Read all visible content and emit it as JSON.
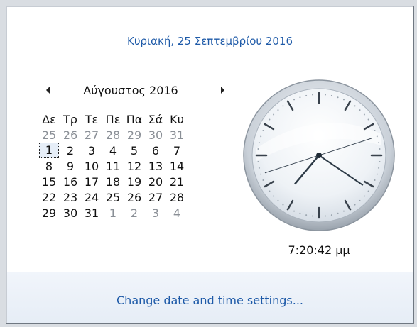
{
  "header": {
    "long_date": "Κυριακή, 25 Σεπτεμβρίου 2016"
  },
  "calendar": {
    "month_title": "Αύγουστος 2016",
    "weekdays": [
      "Δε",
      "Τρ",
      "Τε",
      "Πε",
      "Πα",
      "Σά",
      "Κυ"
    ],
    "weeks": [
      [
        "25",
        "26",
        "27",
        "28",
        "29",
        "30",
        "31"
      ],
      [
        "1",
        "2",
        "3",
        "4",
        "5",
        "6",
        "7"
      ],
      [
        "8",
        "9",
        "10",
        "11",
        "12",
        "13",
        "14"
      ],
      [
        "15",
        "16",
        "17",
        "18",
        "19",
        "20",
        "21"
      ],
      [
        "22",
        "23",
        "24",
        "25",
        "26",
        "27",
        "28"
      ],
      [
        "29",
        "30",
        "31",
        "1",
        "2",
        "3",
        "4"
      ]
    ]
  },
  "clock": {
    "time_text": "7:20:42 μμ",
    "hour": 7,
    "minute": 20,
    "second": 42
  },
  "footer": {
    "link": "Change date and time settings..."
  },
  "colors": {
    "accent": "#1e5aa8",
    "muted_day": "#8a8f96"
  },
  "icons": {
    "prev": "triangle-left-icon",
    "next": "triangle-right-icon"
  }
}
